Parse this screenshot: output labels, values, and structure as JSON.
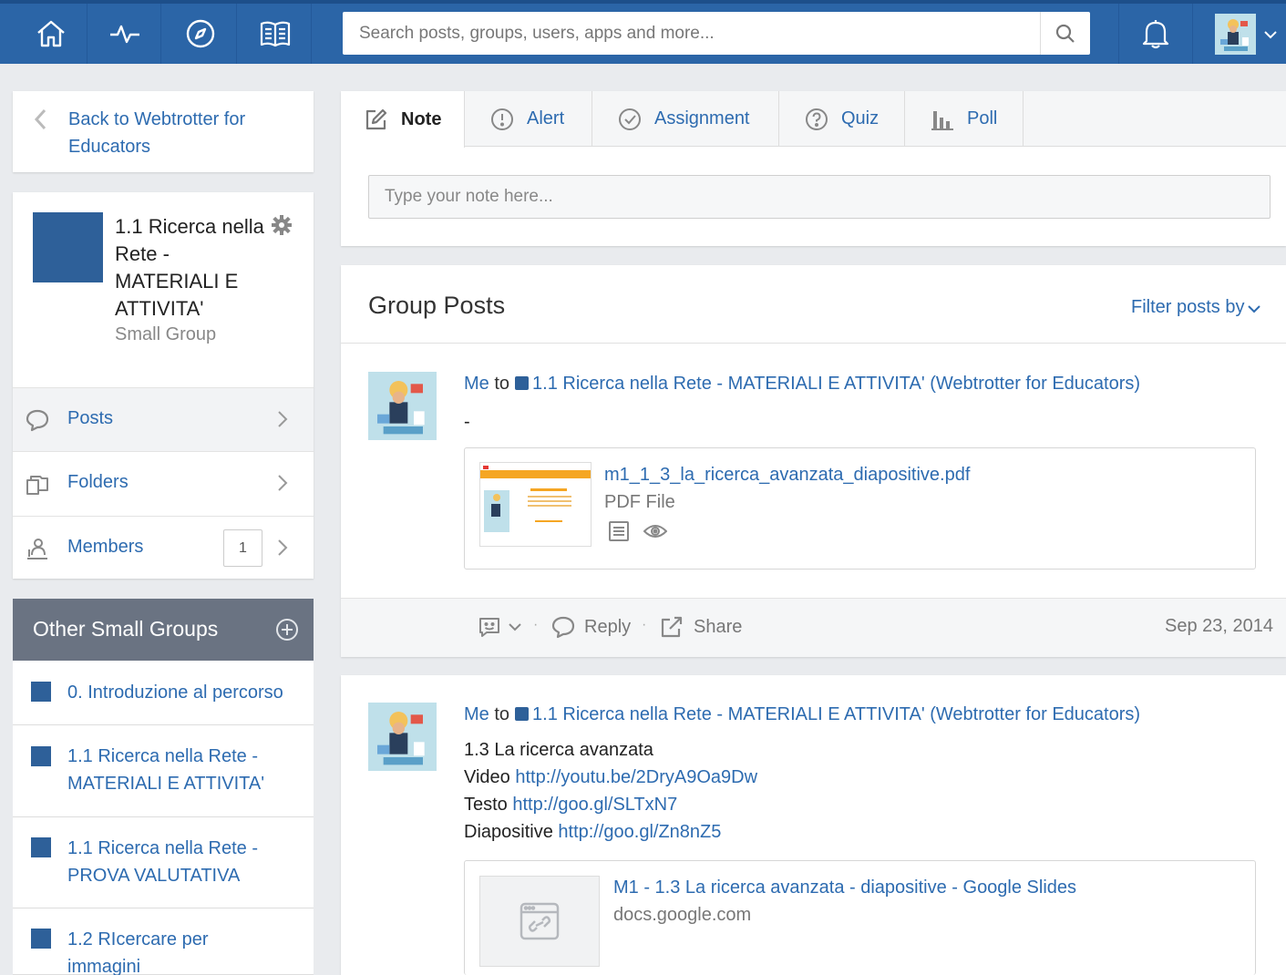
{
  "nav": {
    "icons": [
      "home-icon",
      "activity-icon",
      "explore-icon",
      "resources-icon",
      "bell-icon"
    ],
    "search_placeholder": "Search posts, groups, users, apps and more..."
  },
  "sidebar": {
    "back_link": "Back to Webtrotter for Educators",
    "group": {
      "title": "1.1 Ricerca nella Rete - MATERIALI E ATTIVITA'",
      "type": "Small Group"
    },
    "menu": [
      {
        "label": "Posts",
        "icon": "speech-bubble-icon"
      },
      {
        "label": "Folders",
        "icon": "folders-icon"
      },
      {
        "label": "Members",
        "icon": "members-icon",
        "count": "1"
      }
    ],
    "other_groups": {
      "title": "Other Small Groups",
      "items": [
        "0. Introduzione al percorso",
        "1.1 Ricerca nella Rete - MATERIALI E ATTIVITA'",
        "1.1 Ricerca nella Rete - PROVA VALUTATIVA",
        "1.2 RIcercare per immagini"
      ]
    }
  },
  "composer": {
    "tabs": [
      "Note",
      "Alert",
      "Assignment",
      "Quiz",
      "Poll"
    ],
    "active_tab": "Note",
    "note_placeholder": "Type your note here..."
  },
  "feed": {
    "title": "Group Posts",
    "filter_label": "Filter posts by",
    "posts": [
      {
        "author": "Me",
        "to": "to",
        "target": "1.1 Ricerca nella Rete - MATERIALI E ATTIVITA' (Webtrotter for Educators)",
        "body": "-",
        "attachment": {
          "name": "m1_1_3_la_ricerca_avanzata_diapositive.pdf",
          "type": "PDF File"
        },
        "actions": {
          "reply": "Reply",
          "share": "Share"
        },
        "date": "Sep 23, 2014"
      },
      {
        "author": "Me",
        "to": "to",
        "target": "1.1 Ricerca nella Rete - MATERIALI E ATTIVITA' (Webtrotter for Educators)",
        "lines": [
          {
            "label": "1.3 La ricerca avanzata",
            "link": ""
          },
          {
            "label": "Video ",
            "link": "http://youtu.be/2DryA9Oa9Dw"
          },
          {
            "label": "Testo ",
            "link": "http://goo.gl/SLTxN7"
          },
          {
            "label": "Diapositive ",
            "link": "http://goo.gl/Zn8nZ5"
          }
        ],
        "attachment": {
          "name": "M1 - 1.3 La ricerca avanzata - diapositive - Google Slides",
          "type": "docs.google.com"
        }
      }
    ]
  },
  "colors": {
    "brand": "#2b65a7",
    "link": "#2d6bb0",
    "group": "#2e6099"
  }
}
